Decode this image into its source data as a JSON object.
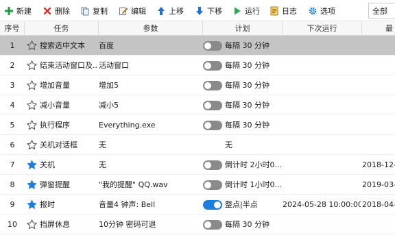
{
  "toolbar": {
    "new_label": "新建",
    "delete_label": "删除",
    "copy_label": "复制",
    "edit_label": "编辑",
    "move_up_label": "上移",
    "move_down_label": "下移",
    "run_label": "运行",
    "log_label": "日志",
    "options_label": "选项",
    "filter_value": "全部"
  },
  "colors": {
    "new_icon": "#1e9e3a",
    "delete_icon": "#d93025",
    "arrow_icon": "#1e6fd9",
    "run_icon": "#2fa84f",
    "log_icon": "#d8a017",
    "options_icon": "#1e7ee0",
    "star_filled": "#1e7ee0",
    "toggle_on": "#1e7ee0",
    "toggle_off": "#8a8a8a",
    "selected_row": "#c4c4c4"
  },
  "table": {
    "headers": {
      "num": "序号",
      "task": "任务",
      "param": "参数",
      "plan": "计划",
      "next": "下次运行",
      "last": "最"
    },
    "rows": [
      {
        "num": "1",
        "starred": false,
        "task": "搜索选中文本",
        "param": "百度",
        "has_toggle": true,
        "enabled": false,
        "plan": "每隔 30 分钟",
        "next": "",
        "last": "",
        "selected": true
      },
      {
        "num": "2",
        "starred": false,
        "task": "结束活动窗口及...",
        "param": "活动窗口",
        "has_toggle": true,
        "enabled": false,
        "plan": "每隔 30 分钟",
        "next": "",
        "last": "",
        "selected": false
      },
      {
        "num": "3",
        "starred": false,
        "task": "增加音量",
        "param": "增加5",
        "has_toggle": true,
        "enabled": false,
        "plan": "每隔 30 分钟",
        "next": "",
        "last": "",
        "selected": false
      },
      {
        "num": "4",
        "starred": false,
        "task": "减小音量",
        "param": "减小5",
        "has_toggle": true,
        "enabled": false,
        "plan": "每隔 30 分钟",
        "next": "",
        "last": "",
        "selected": false
      },
      {
        "num": "5",
        "starred": false,
        "task": "执行程序",
        "param": "Everything.exe",
        "has_toggle": true,
        "enabled": false,
        "plan": "每隔 30 分钟",
        "next": "",
        "last": "",
        "selected": false
      },
      {
        "num": "6",
        "starred": false,
        "task": "关机对话框",
        "param": "无",
        "has_toggle": false,
        "enabled": false,
        "plan": "无",
        "next": "",
        "last": "",
        "selected": false
      },
      {
        "num": "7",
        "starred": true,
        "task": "关机",
        "param": "无",
        "has_toggle": true,
        "enabled": false,
        "plan": "倒计时 2小时0...",
        "next": "",
        "last": "2018-12-",
        "selected": false
      },
      {
        "num": "8",
        "starred": true,
        "task": "弹窗提醒",
        "param": "\"我的提醒\" QQ.wav",
        "has_toggle": true,
        "enabled": false,
        "plan": "倒计时 1小时0...",
        "next": "",
        "last": "2019-03-",
        "selected": false
      },
      {
        "num": "9",
        "starred": true,
        "task": "报时",
        "param": "音量4 钟声: Bell",
        "has_toggle": true,
        "enabled": true,
        "plan": "整点|半点",
        "next": "2024-05-28 10:00:00",
        "last": "2018-04-",
        "selected": false
      },
      {
        "num": "10",
        "starred": false,
        "task": "挡屏休息",
        "param": "10分钟 密码可退",
        "has_toggle": true,
        "enabled": false,
        "plan": "每隔 30 分钟",
        "next": "",
        "last": "",
        "selected": false
      }
    ]
  }
}
